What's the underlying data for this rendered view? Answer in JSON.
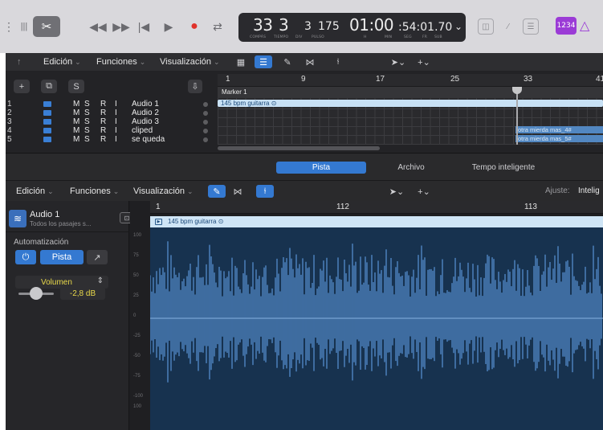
{
  "transport": {
    "bars": "33",
    "beats": "3",
    "division": "3",
    "ticks": "175",
    "time_main": "01:00",
    "time_sub": ":54:01.70",
    "labels": [
      "COMPÁS",
      "TIEMPO",
      "DIV",
      "PULSO",
      "H",
      "MIN",
      "SEG",
      "FR",
      "SUB"
    ]
  },
  "count_in": "1234",
  "tracks_toolbar": {
    "edit": "Edición",
    "functions": "Funciones",
    "view": "Visualización"
  },
  "track_header": {
    "add": "+",
    "s": "S"
  },
  "tracks": [
    {
      "num": "1",
      "name": "Audio 1"
    },
    {
      "num": "2",
      "name": "Audio 2"
    },
    {
      "num": "3",
      "name": "Audio 3"
    },
    {
      "num": "4",
      "name": "cliped"
    },
    {
      "num": "5",
      "name": "se queda"
    }
  ],
  "track_buttons": {
    "m": "M",
    "s": "S",
    "r": "R",
    "i": "I"
  },
  "ruler": [
    "1",
    "9",
    "17",
    "25",
    "33",
    "41"
  ],
  "marker": "Marker 1",
  "regions": {
    "main": "145 bpm guitarra",
    "small1": "otra mierda mas_4#",
    "small2": "otra mierda mas_5#"
  },
  "editor": {
    "tabs": [
      "Pista",
      "Archivo",
      "Tempo inteligente"
    ],
    "active_tab": "Pista",
    "menu": {
      "edit": "Edición",
      "functions": "Funciones",
      "view": "Visualización"
    },
    "ajuste_label": "Ajuste:",
    "ajuste_value": "Intelig",
    "ruler": [
      "1",
      "112",
      "113"
    ],
    "region_label": "145 bpm guitarra",
    "vscale": [
      "100",
      "75",
      "50",
      "25",
      "0",
      "-25",
      "-50",
      "-75",
      "-100",
      "100"
    ]
  },
  "inspector": {
    "region_name": "Audio 1",
    "region_sub": "Todos los pasajes s...",
    "automation_label": "Automatización",
    "track_btn": "Pista",
    "param": "Volumen",
    "volume_value": "-2,8 dB"
  },
  "colors": {
    "accent": "#3479d1",
    "region": "#c8e1f5",
    "yellow": "#e8d84a",
    "purple": "#9b3bd6"
  }
}
